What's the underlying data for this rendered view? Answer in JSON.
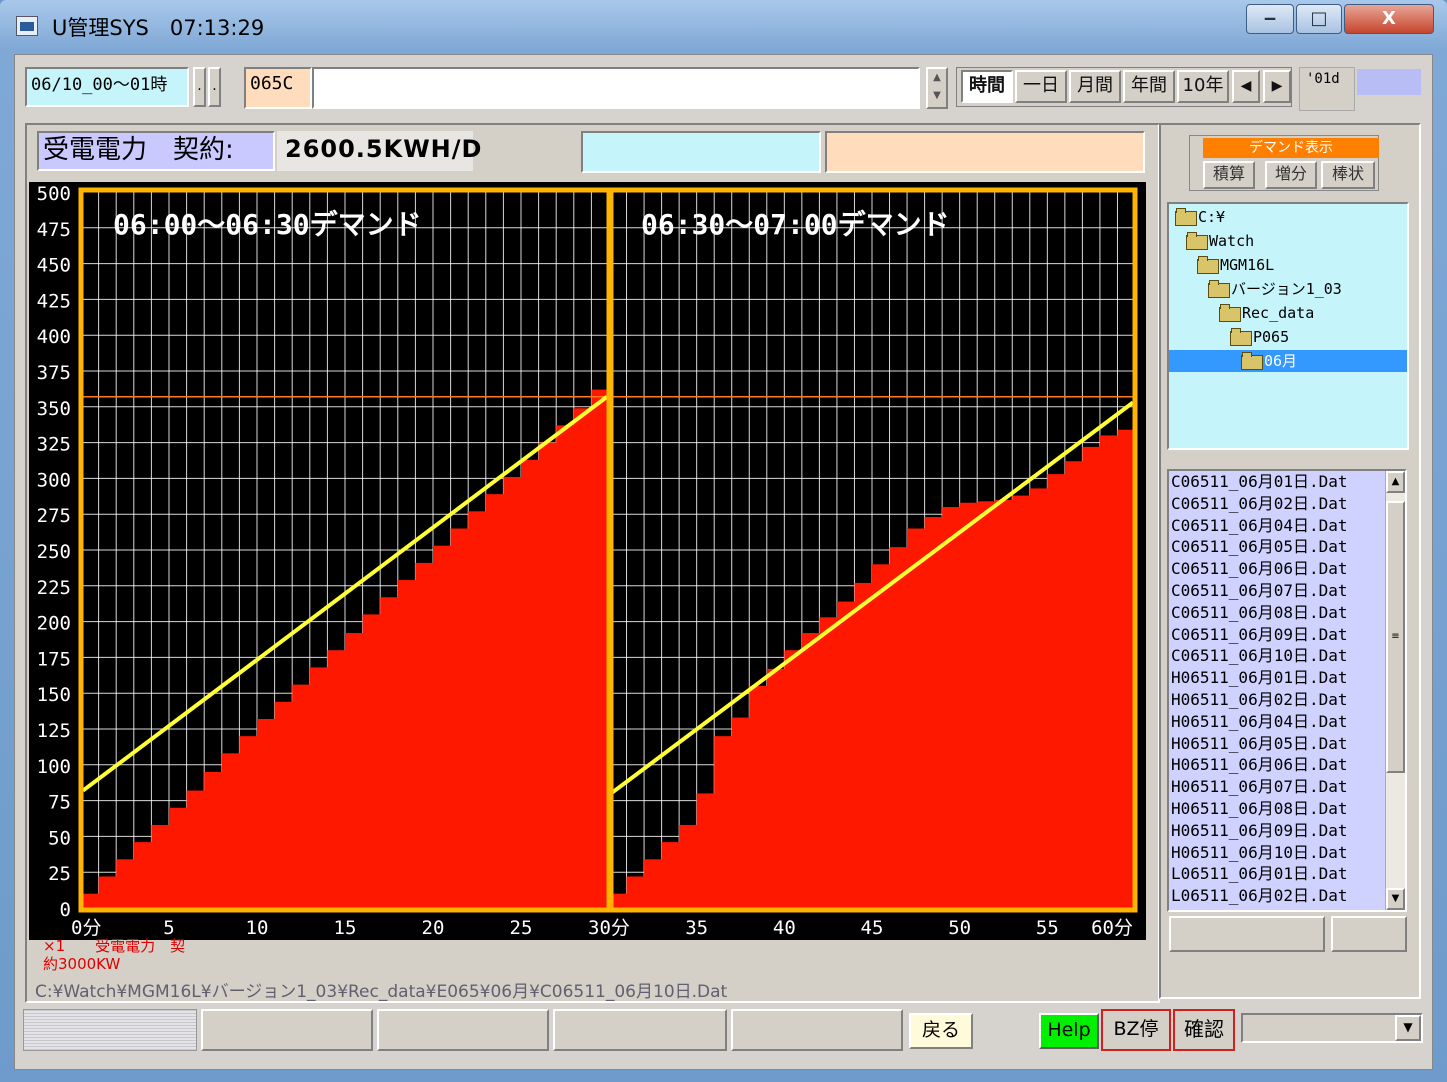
{
  "window": {
    "title": "U管理SYS　07:13:29",
    "min": "‒",
    "max": "□",
    "close": "X"
  },
  "toolbar": {
    "date_range": "06/10_00～01時",
    "spin_dots": ".",
    "code": "065C",
    "text_field": "",
    "tabs": [
      "時間",
      "一日",
      "月間",
      "年間",
      "10年"
    ],
    "active_tab": "時間",
    "prev": "◀",
    "next": "▶",
    "counter": "'01d"
  },
  "header": {
    "label": "受電電力　契約:",
    "contract_value": "2600.5KWH/D",
    "field_a": "",
    "field_b": ""
  },
  "colors": {
    "bar_fill": "#ff1800",
    "target_line": "#ffff33",
    "frame": "#ffb400",
    "limit_line": "#ff7a1a",
    "grid": "#ffffff"
  },
  "chart_data": {
    "type": "bar",
    "ylim": [
      0,
      500
    ],
    "yticks": [
      "500",
      "475",
      "450",
      "425",
      "400",
      "375",
      "350",
      "325",
      "300",
      "275",
      "250",
      "225",
      "200",
      "175",
      "150",
      "125",
      "100",
      "75",
      "50",
      "25",
      "0"
    ],
    "xticks": [
      "0分",
      "5",
      "10",
      "15",
      "20",
      "25",
      "30分",
      "35",
      "40",
      "45",
      "50",
      "55",
      "60分"
    ],
    "limit_value": 357,
    "panels": [
      {
        "title": "06:00～06:30デマンド",
        "x_minutes": [
          0,
          1,
          2,
          3,
          4,
          5,
          6,
          7,
          8,
          9,
          10,
          11,
          12,
          13,
          14,
          15,
          16,
          17,
          18,
          19,
          20,
          21,
          22,
          23,
          24,
          25,
          26,
          27,
          28,
          29
        ],
        "values": [
          10,
          22,
          34,
          46,
          58,
          70,
          82,
          95,
          108,
          120,
          132,
          144,
          156,
          168,
          180,
          192,
          205,
          217,
          229,
          241,
          253,
          265,
          277,
          289,
          301,
          313,
          325,
          337,
          349,
          362
        ],
        "target_line": {
          "start": 82,
          "end": 357
        }
      },
      {
        "title": "06:30～07:00デマンド",
        "x_minutes": [
          30,
          31,
          32,
          33,
          34,
          35,
          36,
          37,
          38,
          39,
          40,
          41,
          42,
          43,
          44,
          45,
          46,
          47,
          48,
          49,
          50,
          51,
          52,
          53,
          54,
          55,
          56,
          57,
          58,
          59
        ],
        "values": [
          10,
          22,
          34,
          46,
          58,
          80,
          120,
          133,
          155,
          167,
          180,
          192,
          203,
          214,
          227,
          240,
          252,
          265,
          273,
          280,
          283,
          284,
          285,
          288,
          293,
          303,
          312,
          322,
          330,
          334
        ],
        "target_line": {
          "start": 80,
          "end": 353
        }
      }
    ]
  },
  "legend": {
    "line1": "×1　　受電電力　契",
    "line2": "約3000KW"
  },
  "path": "C:¥Watch¥MGM16L¥バージョン1_03¥Rec_data¥E065¥06月¥C06511_06月10日.Dat",
  "demand_box": {
    "title": "デマンド表示",
    "buttons": [
      "積算",
      "増分",
      "棒状"
    ]
  },
  "tree": [
    {
      "label": "C:¥",
      "level": 0
    },
    {
      "label": "Watch",
      "level": 1
    },
    {
      "label": "MGM16L",
      "level": 2
    },
    {
      "label": "バージョン1_03",
      "level": 3
    },
    {
      "label": "Rec_data",
      "level": 4
    },
    {
      "label": "P065",
      "level": 5
    },
    {
      "label": "06月",
      "level": 6,
      "selected": true
    }
  ],
  "files": [
    "C06511_06月01日.Dat",
    "C06511_06月02日.Dat",
    "C06511_06月04日.Dat",
    "C06511_06月05日.Dat",
    "C06511_06月06日.Dat",
    "C06511_06月07日.Dat",
    "C06511_06月08日.Dat",
    "C06511_06月09日.Dat",
    "C06511_06月10日.Dat",
    "H06511_06月01日.Dat",
    "H06511_06月02日.Dat",
    "H06511_06月04日.Dat",
    "H06511_06月05日.Dat",
    "H06511_06月06日.Dat",
    "H06511_06月07日.Dat",
    "H06511_06月08日.Dat",
    "H06511_06月09日.Dat",
    "H06511_06月10日.Dat",
    "L06511_06月01日.Dat",
    "L06511_06月02日.Dat"
  ],
  "bottom": {
    "back": "戻る",
    "help": "Help",
    "bz_stop": "BZ停",
    "confirm": "確認",
    "dropdown_value": ""
  }
}
